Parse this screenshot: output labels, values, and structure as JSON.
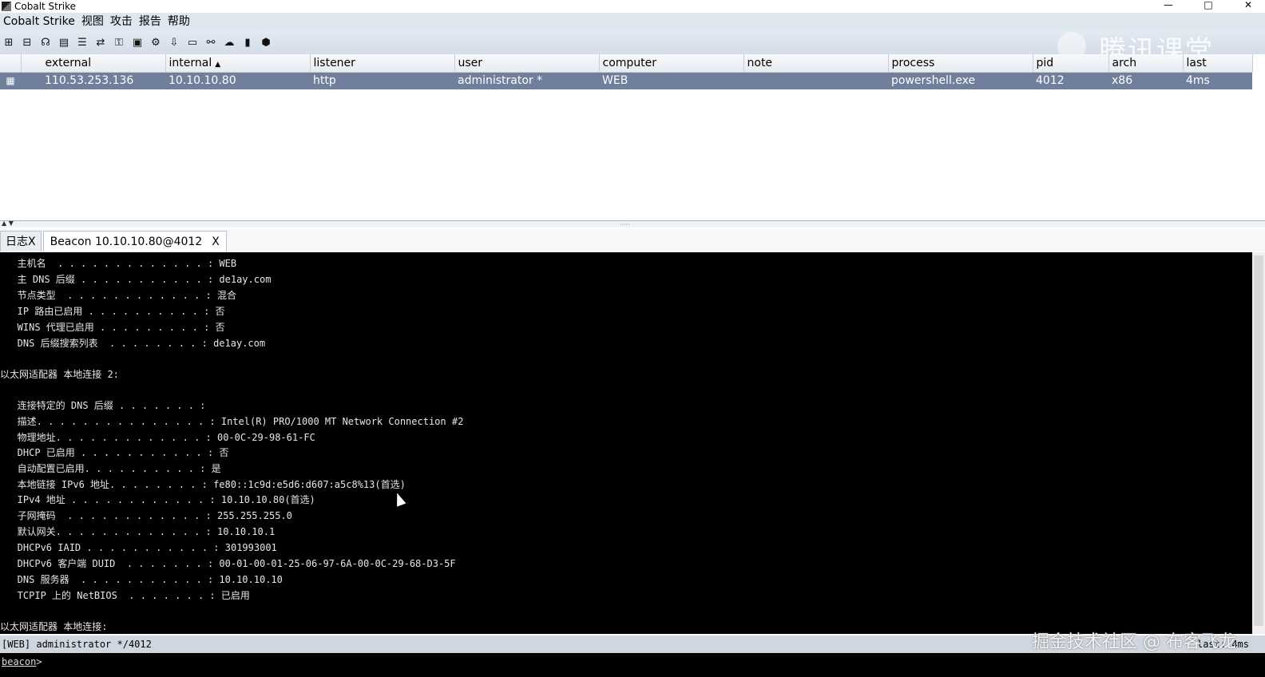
{
  "window": {
    "title": "Cobalt Strike",
    "controls": [
      "—",
      "□",
      "✕"
    ]
  },
  "menu": [
    "Cobalt Strike",
    "视图",
    "攻击",
    "报告",
    "帮助"
  ],
  "toolbar_icons": [
    "add-icon",
    "connect-icon",
    "headphones-icon",
    "targets-icon",
    "list-icon",
    "pivot-icon",
    "keys-icon",
    "image-icon",
    "gear-icon",
    "download-icon",
    "terminal-icon",
    "link-icon",
    "cloud-icon",
    "book-icon",
    "package-icon"
  ],
  "watermarks": {
    "top": "腾讯课堂",
    "bottom": "掘金技术社区 @ 布客飞龙"
  },
  "table": {
    "columns": [
      "external",
      "internal",
      "listener",
      "user",
      "computer",
      "note",
      "process",
      "pid",
      "arch",
      "last"
    ],
    "sort_indicator": "▲",
    "rows": [
      [
        "110.53.253.136",
        "10.10.10.80",
        "http",
        "administrator *",
        "WEB",
        "",
        "powershell.exe",
        "4012",
        "x86",
        "4ms"
      ]
    ]
  },
  "tabs": [
    {
      "label": "日志",
      "close": "X"
    },
    {
      "label": "Beacon 10.10.10.80@4012",
      "close": "X"
    }
  ],
  "console_lines": [
    "   主机名  . . . . . . . . . . . . . : WEB",
    "   主 DNS 后缀 . . . . . . . . . . . : de1ay.com",
    "   节点类型  . . . . . . . . . . . . : 混合",
    "   IP 路由已启用 . . . . . . . . . . : 否",
    "   WINS 代理已启用 . . . . . . . . . : 否",
    "   DNS 后缀搜索列表  . . . . . . . . : de1ay.com",
    "",
    "以太网适配器 本地连接 2:",
    "",
    "   连接特定的 DNS 后缀 . . . . . . . :",
    "   描述. . . . . . . . . . . . . . . : Intel(R) PRO/1000 MT Network Connection #2",
    "   物理地址. . . . . . . . . . . . . : 00-0C-29-98-61-FC",
    "   DHCP 已启用 . . . . . . . . . . . : 否",
    "   自动配置已启用. . . . . . . . . . : 是",
    "   本地链接 IPv6 地址. . . . . . . . : fe80::1c9d:e5d6:d607:a5c8%13(首选)",
    "   IPv4 地址 . . . . . . . . . . . . : 10.10.10.80(首选)",
    "   子网掩码  . . . . . . . . . . . . : 255.255.255.0",
    "   默认网关. . . . . . . . . . . . . : 10.10.10.1",
    "   DHCPv6 IAID . . . . . . . . . . . : 301993001",
    "   DHCPv6 客户端 DUID  . . . . . . . : 00-01-00-01-25-06-97-6A-00-0C-29-68-D3-5F",
    "   DNS 服务器  . . . . . . . . . . . : 10.10.10.10",
    "   TCPIP 上的 NetBIOS  . . . . . . . : 已启用",
    "",
    "以太网适配器 本地连接:"
  ],
  "status": {
    "left": "[WEB] administrator */4012",
    "right": "last: 4ms"
  },
  "prompt": "beacon",
  "prompt_symbol": ">"
}
